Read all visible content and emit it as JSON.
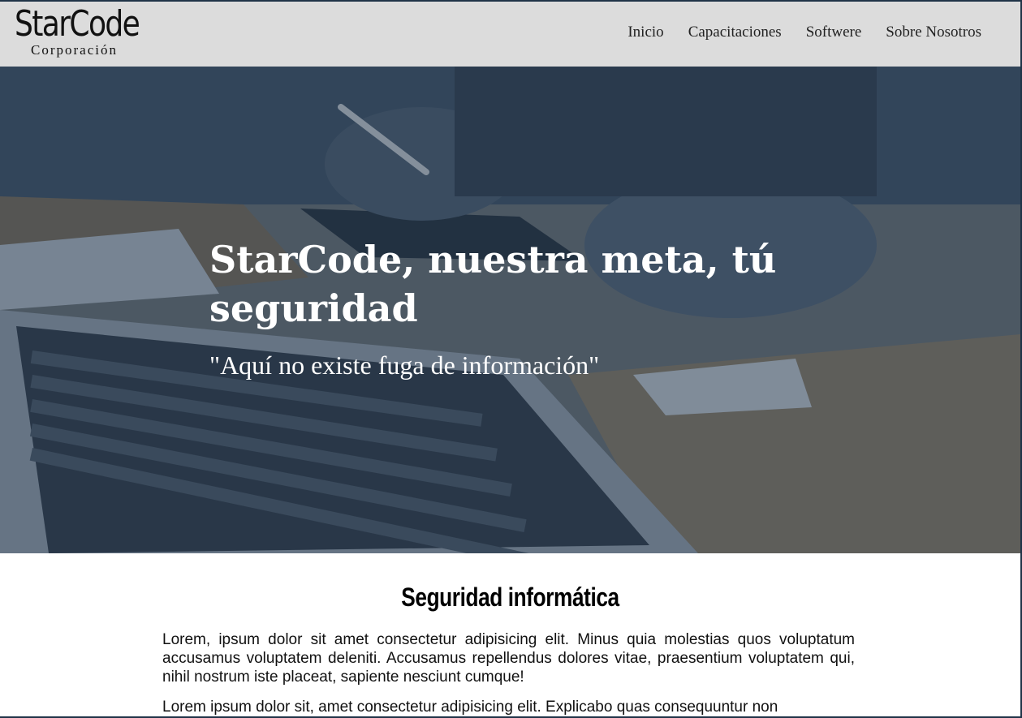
{
  "header": {
    "logo_main": "StarCode",
    "logo_sub": "Corporación",
    "nav": [
      "Inicio",
      "Capacitaciones",
      "Softwere",
      "Sobre Nosotros"
    ]
  },
  "hero": {
    "title": "StarCode, nuestra meta, tú seguridad",
    "quote": "\"Aquí no existe fuga de información\""
  },
  "section": {
    "title": "Seguridad informática",
    "paragraphs": [
      "Lorem, ipsum dolor sit amet consectetur adipisicing elit. Minus quia molestias quos voluptatum accusamus voluptatem deleniti. Accusamus repellendus dolores vitae, praesentium voluptatem qui, nihil nostrum iste placeat, sapiente nesciunt cumque!",
      "Lorem ipsum dolor sit, amet consectetur adipisicing elit. Explicabo quas consequuntur non"
    ]
  },
  "colors": {
    "header_bg": "#dcdcdc",
    "hero_overlay": "#2c3e50",
    "accent_border": "#1f3347"
  }
}
